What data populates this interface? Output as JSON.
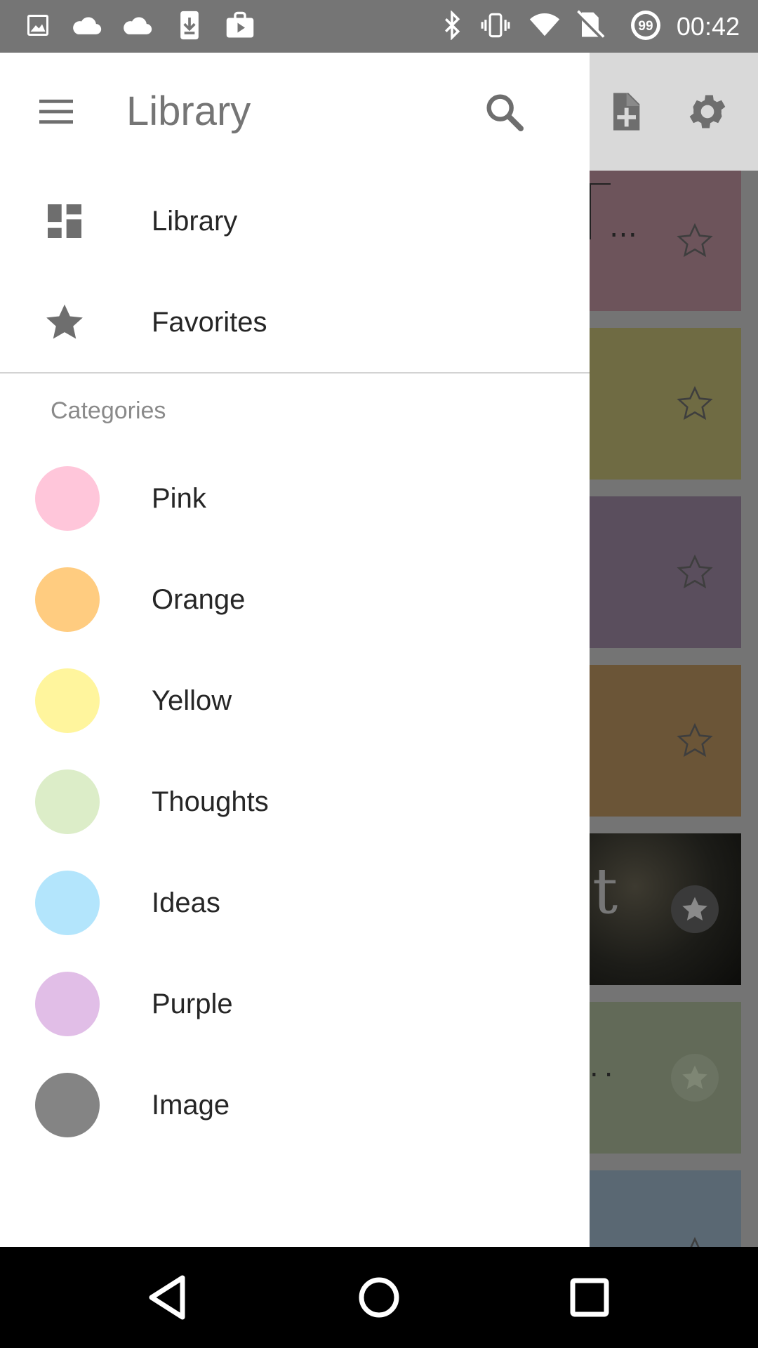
{
  "status_bar": {
    "time": "00:42",
    "battery_level": "99",
    "icons": [
      "image-icon",
      "cloud-icon",
      "cloud-icon",
      "download-icon",
      "play-store-icon",
      "bluetooth-icon",
      "vibrate-icon",
      "wifi-icon",
      "no-sim-icon",
      "battery-saver-icon"
    ]
  },
  "background": {
    "toolbar_icons": [
      "new-note-icon",
      "settings-icon"
    ],
    "notes": [
      {
        "color": "#6d545b",
        "text": "…",
        "favorite": false
      },
      {
        "color": "#6f6b43",
        "text": "",
        "favorite": false
      },
      {
        "color": "#5a4e5d",
        "text": "",
        "favorite": false
      },
      {
        "color": "#6b5537",
        "text": "",
        "favorite": false
      },
      {
        "color": "#1e1e1a",
        "text": "t",
        "favorite": true
      },
      {
        "color": "#626a58",
        "text": "..",
        "favorite": true
      },
      {
        "color": "#5a6873",
        "text": "",
        "favorite": false
      }
    ]
  },
  "drawer": {
    "title": "Library",
    "nav_items": [
      {
        "label": "Library",
        "icon": "dashboard-icon"
      },
      {
        "label": "Favorites",
        "icon": "star-icon"
      }
    ],
    "section_header": "Categories",
    "categories": [
      {
        "label": "Pink",
        "color": "#ffc6da"
      },
      {
        "label": "Orange",
        "color": "#ffcc80"
      },
      {
        "label": "Yellow",
        "color": "#fff59d"
      },
      {
        "label": "Thoughts",
        "color": "#dcedc8"
      },
      {
        "label": "Ideas",
        "color": "#b3e5fc"
      },
      {
        "label": "Purple",
        "color": "#e1bee7"
      },
      {
        "label": "Image",
        "color": "#848484"
      }
    ]
  },
  "nav_bar": {
    "buttons": [
      "back-icon",
      "home-icon",
      "recents-icon"
    ]
  }
}
